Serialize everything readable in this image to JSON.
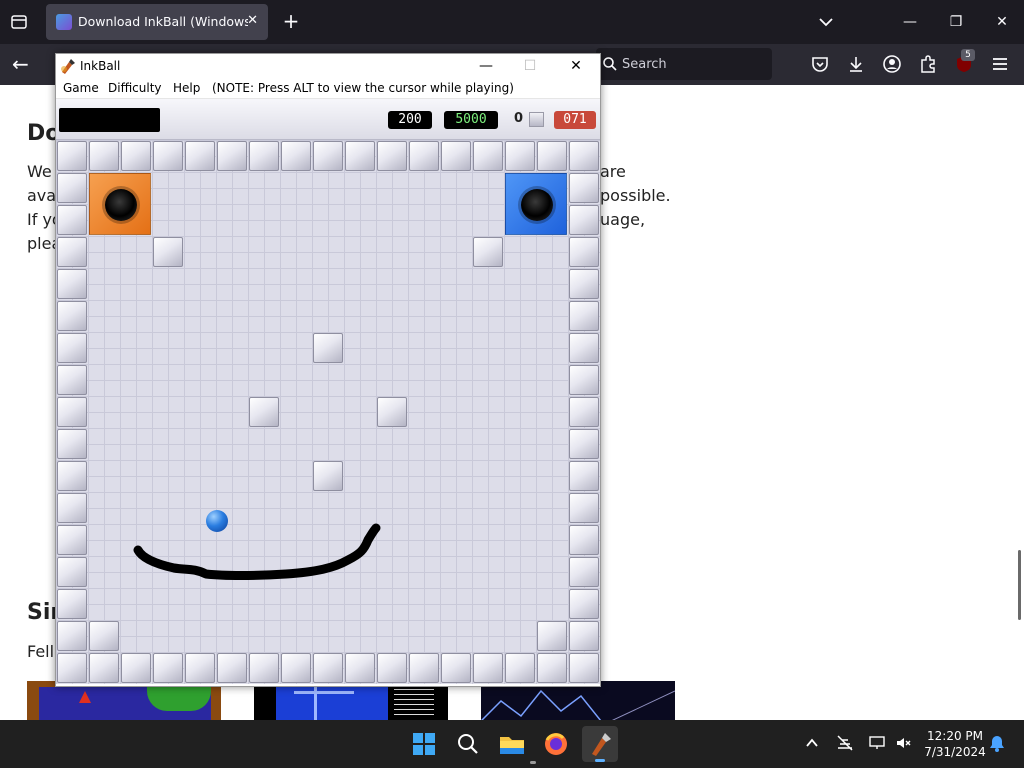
{
  "browser": {
    "tab_title": "Download InkBall (Windows) - I",
    "search_placeholder": "Search",
    "extension_badge": "5"
  },
  "webpage": {
    "heading_1": "Do",
    "para_line_1_left": "We",
    "para_line_1_right": "are",
    "para_line_2_left": "ava",
    "para_line_2_right": "possible.",
    "para_line_3_left": "If yo",
    "para_line_3_right": "uage,",
    "para_line_4_left": "plea",
    "heading_2": "Sin",
    "para_2_left": "Fell"
  },
  "inkball": {
    "title": "InkBall",
    "menu": [
      "Game",
      "Difficulty",
      "Help",
      "(NOTE: Press ALT to view the cursor while playing)"
    ],
    "score": "200",
    "target": "5000",
    "balls_remaining": "0",
    "timer": "071",
    "colors": {
      "orange_hole": "#f08a2a",
      "blue_hole": "#2f7ff0",
      "ball": "#1f6fd8",
      "timer_bg": "#c8483a",
      "target_text": "#7ef07e"
    }
  },
  "taskbar": {
    "time": "12:20 PM",
    "date": "7/31/2024",
    "apps": [
      "windows-start",
      "search",
      "file-explorer",
      "firefox",
      "inkball"
    ]
  }
}
